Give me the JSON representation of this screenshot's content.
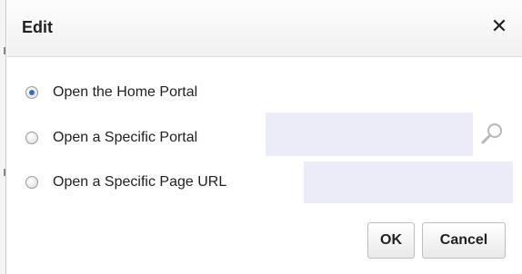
{
  "dialog": {
    "title": "Edit",
    "close_symbol": "✕"
  },
  "options": [
    {
      "label": "Open the Home Portal",
      "checked": true
    },
    {
      "label": "Open a Specific Portal",
      "checked": false
    },
    {
      "label": "Open a Specific Page URL",
      "checked": false
    }
  ],
  "fields": {
    "portal_value": "",
    "page_url_value": ""
  },
  "icons": {
    "search": "search-icon",
    "close": "close-icon"
  },
  "buttons": {
    "ok_label": "OK",
    "cancel_label": "Cancel"
  },
  "colors": {
    "field_bg": "#ecebf8",
    "radio_selected": "#3a6fb7"
  }
}
